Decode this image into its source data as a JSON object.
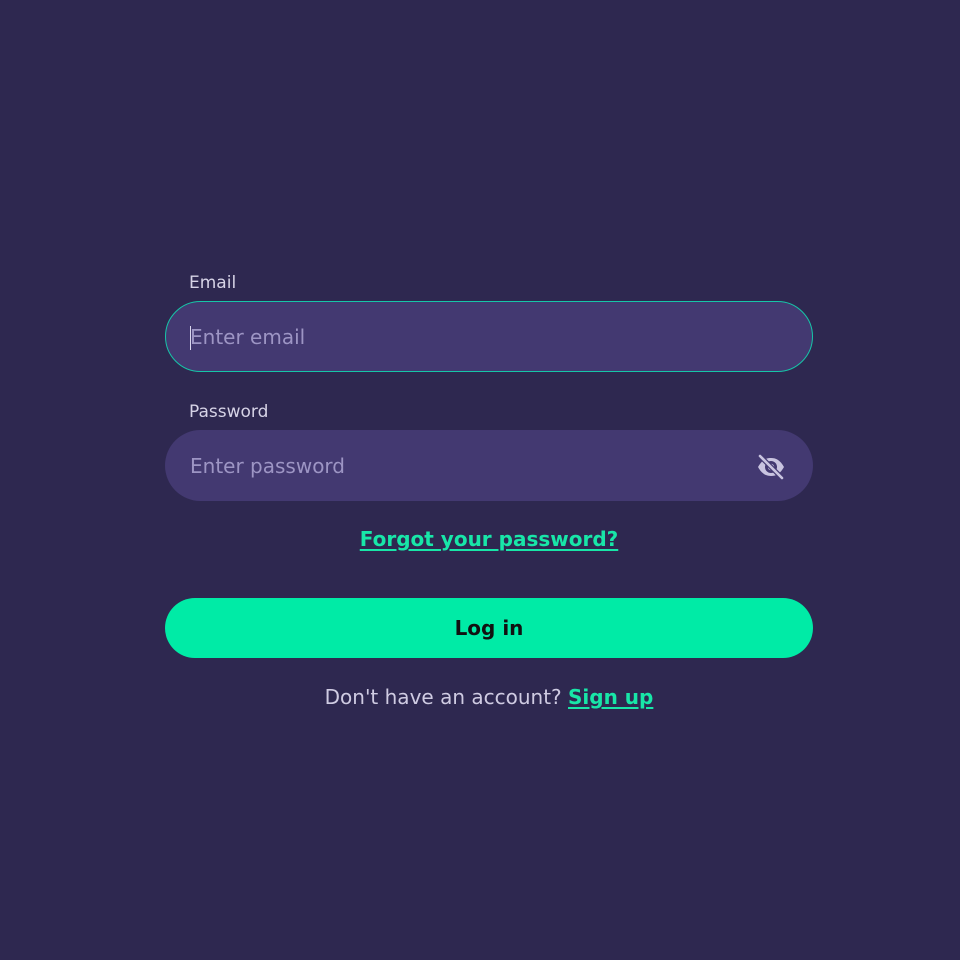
{
  "login_form": {
    "email": {
      "label": "Email",
      "placeholder": "Enter email",
      "value": ""
    },
    "password": {
      "label": "Password",
      "placeholder": "Enter password",
      "value": "",
      "toggle_icon": "eye-off-icon"
    },
    "forgot_password_link": "Forgot your password?",
    "login_button": "Log in",
    "signup_prompt": "Don't have an account?",
    "signup_link": "Sign up"
  },
  "colors": {
    "background": "#2e2850",
    "input_background": "#433971",
    "focus_border": "#16c6a8",
    "accent": "#00eba6"
  }
}
